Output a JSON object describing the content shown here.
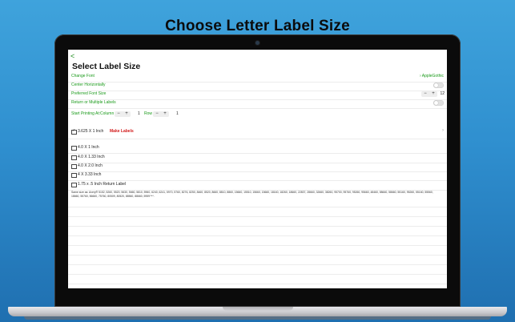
{
  "headline": "Choose Letter Label Size",
  "app": {
    "back_glyph": "<",
    "title": "Select Label Size",
    "change_font": {
      "label": "Change Font",
      "value": "AppleGothic",
      "value_prefix": "›"
    },
    "center_horizontally": {
      "label": "Center Horizontally",
      "on": false
    },
    "preferred_font_size": {
      "label": "Preferred Font Size",
      "minus": "−",
      "plus": "+",
      "value": "12"
    },
    "return_multiple": {
      "label": "Return or Multiple Labels",
      "on": false
    },
    "start_printing": {
      "label": "Start Printing At:",
      "column_label": "Column",
      "minus": "−",
      "plus": "+",
      "column_value": "1",
      "row_label": "Row",
      "row_value": "1"
    },
    "sizes": [
      {
        "text": "3.625 X 1 Inch",
        "checked": true,
        "make_labels": "Make Labels",
        "chevron": "›"
      },
      {
        "text": "4.0 X 1 Inch",
        "checked": false
      },
      {
        "text": "4.0 X 1.33 Inch",
        "checked": false
      },
      {
        "text": "4.0 X 2.0 Inch",
        "checked": false
      },
      {
        "text": "4 X 3.33 Inch",
        "checked": false
      },
      {
        "text": "1.75 x .5 Inch Return Label",
        "checked": false
      }
    ],
    "footnote": "Same size as: Avery® 5152, 5260, 5520, 5630, 5660, 5810, 5960, 6240, 6241, 5970, 5760, 8276, 8250, 8460, 8520, 8660, 8810, 8860, 15660, 15510, 15660, 15660, 18160, 18260, 18660, 22837, 28660, 32660, 38260, 95700, 95760, 95260, 95660, 48460, 58660, 58660, 55160, 95260, 55160, 55560, 18660, 55760, 56660, 75760, 80509, 80520, 88560, 88660, 5959™*."
  },
  "colors": {
    "accent_green": "#1a9a1a",
    "make_labels_red": "#d21a1a",
    "background_top": "#3fa3dc",
    "background_bottom": "#1f6fb0"
  }
}
